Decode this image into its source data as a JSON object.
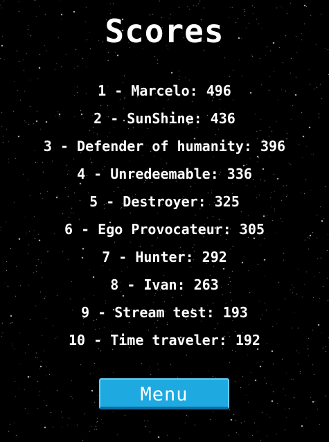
{
  "screen": {
    "title": "Scores"
  },
  "scores": [
    "1 - Marcelo: 496",
    "2 - SunShine: 436",
    "3 - Defender of humanity: 396",
    "4 - Unredeemable: 336",
    "5 - Destroyer: 325",
    "6 - Ego Provocateur: 305",
    "7 - Hunter: 292",
    "8 - Ivan: 263",
    "9 - Stream test: 193",
    "10 - Time traveler: 192"
  ],
  "menu_button": {
    "label": "Menu"
  },
  "colors": {
    "background": "#000000",
    "text": "#ffffff",
    "button": "#1fa9e1",
    "button_shadow": "#0e6fa3"
  }
}
